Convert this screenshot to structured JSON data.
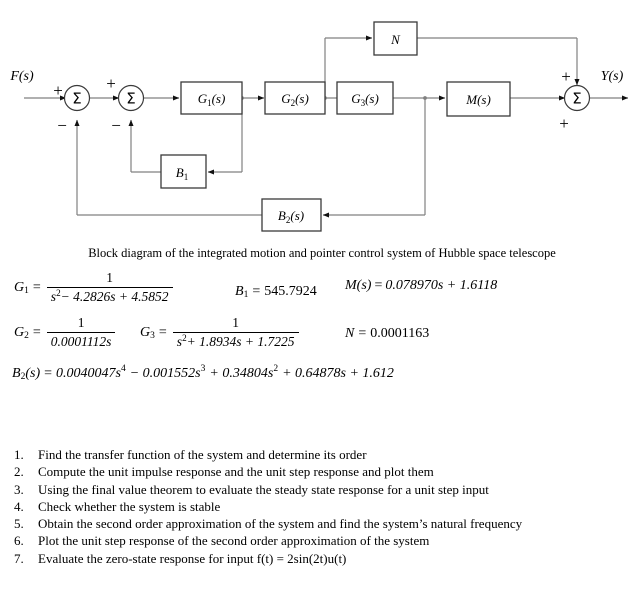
{
  "diagram": {
    "input_label": "F(s)",
    "output_label": "Y(s)",
    "sum1": {
      "glyph": "Σ",
      "sign_in": "+",
      "sign_fb": "−"
    },
    "sum2": {
      "glyph": "Σ",
      "sign_in": "+",
      "sign_fb": "−"
    },
    "sum3": {
      "glyph": "Σ",
      "sign_top": "+",
      "sign_bottom": "+"
    },
    "blocks": {
      "g1": {
        "base": "G",
        "sub": "1",
        "arg": "(s)"
      },
      "g2": {
        "base": "G",
        "sub": "2",
        "arg": "(s)"
      },
      "g3": {
        "base": "G",
        "sub": "3",
        "arg": "(s)"
      },
      "m": {
        "base": "M",
        "sub": "",
        "arg": "(s)"
      },
      "n": {
        "base": "N",
        "sub": "",
        "arg": ""
      },
      "b1": {
        "base": "B",
        "sub": "1",
        "arg": ""
      },
      "b2": {
        "base": "B",
        "sub": "2",
        "arg": "(s)"
      }
    }
  },
  "caption": "Block diagram of the integrated motion and pointer control system of Hubble space telescope",
  "equations": {
    "g1": {
      "lhs_base": "G",
      "lhs_sub": "1",
      "eq": "=",
      "numerator": "1",
      "den_s": "s",
      "den_sup": "2",
      "den_rest": "− 4.2826s + 4.5852"
    },
    "b1": {
      "lhs_base": "B",
      "lhs_sub": "1",
      "eq": "=",
      "value": "545.7924"
    },
    "m": {
      "lhs": "M(s)",
      "eq": "=",
      "value": "0.078970s + 1.6118"
    },
    "g2": {
      "lhs_base": "G",
      "lhs_sub": "2",
      "eq": "=",
      "numerator": "1",
      "denominator": "0.0001112s"
    },
    "g3": {
      "lhs_base": "G",
      "lhs_sub": "3",
      "eq": "=",
      "numerator": "1",
      "den_s": "s",
      "den_sup": "2",
      "den_rest": "+ 1.8934s + 1.7225"
    },
    "n": {
      "lhs": "N",
      "eq": "=",
      "value": "0.0001163"
    },
    "b2": {
      "lhs_base": "B",
      "lhs_sub": "2",
      "lhs_arg": "(s)",
      "eq": "=",
      "t1_coef": "0.0040047s",
      "t1_sup": "4",
      "t2_coef": "− 0.001552s",
      "t2_sup": "3",
      "t3_coef": "+ 0.34804s",
      "t3_sup": "2",
      "t4": "+ 0.64878s + 1.612"
    }
  },
  "tasks": [
    {
      "num": "1.",
      "text": "Find the transfer function of the system and determine its order",
      "justify": false
    },
    {
      "num": "2.",
      "text": "Compute the unit impulse response and the unit step response and plot them",
      "justify": false
    },
    {
      "num": "3.",
      "text": "Using the final value theorem to evaluate the steady state response for a unit step input",
      "justify": false
    },
    {
      "num": "4.",
      "text": "Check whether the system is stable",
      "justify": false
    },
    {
      "num": "5.",
      "text": "Obtain the second order approximation of the system and find the system’s natural frequency",
      "justify": true
    },
    {
      "num": "6.",
      "text": "Plot the unit step response of the second order approximation of the system",
      "justify": false
    },
    {
      "num": "7.",
      "text": "Evaluate the zero-state response for input f(t) = 2sin(2t)u(t)",
      "justify": false
    }
  ],
  "colors": {
    "line": "#808080",
    "box_border": "#3a3a3a",
    "text": "#000000",
    "background": "#ffffff"
  }
}
